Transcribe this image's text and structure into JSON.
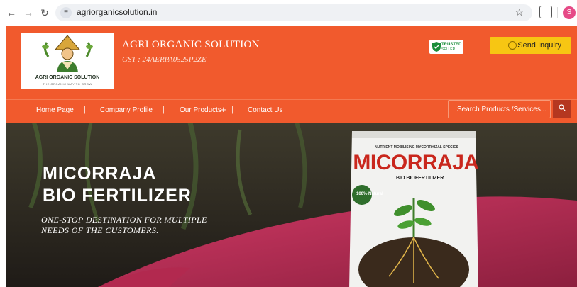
{
  "browser": {
    "url": "agriorganicsolution.in",
    "profile_initial": "S"
  },
  "header": {
    "logo_name": "AGRI ORGANIC SOLUTION",
    "logo_tagline": "THE ORGANIC WAY TO GROW",
    "company_name": "AGRI ORGANIC SOLUTION",
    "gst": "GST : 24AERPA0525P2ZE",
    "trusted_badge": {
      "line1": "TRUSTED",
      "line2": "SELLER"
    },
    "inquiry_label": "Send Inquiry",
    "colors": {
      "brand": "#f15a2d",
      "accent": "#f7c613"
    }
  },
  "nav": {
    "items": [
      "Home Page",
      "Company Profile",
      "Our Products",
      "Contact Us"
    ],
    "products_plus": "+",
    "search_placeholder": "Search Products /Services..."
  },
  "banner": {
    "title_line1": "MICORRAJA",
    "title_line2": "BIO FERTILIZER",
    "subtitle_line1": "ONE-STOP DESTINATION FOR MULTIPLE",
    "subtitle_line2": "NEEDS OF THE CUSTOMERS.",
    "bag_top": "NUTRIENT MOBILISING MYCORRHIZAL SPECIES",
    "bag_brand": "MICORRAJA",
    "bag_sub": "BIO BIOFERTILIZER",
    "bag_seal": "100% Natural"
  }
}
